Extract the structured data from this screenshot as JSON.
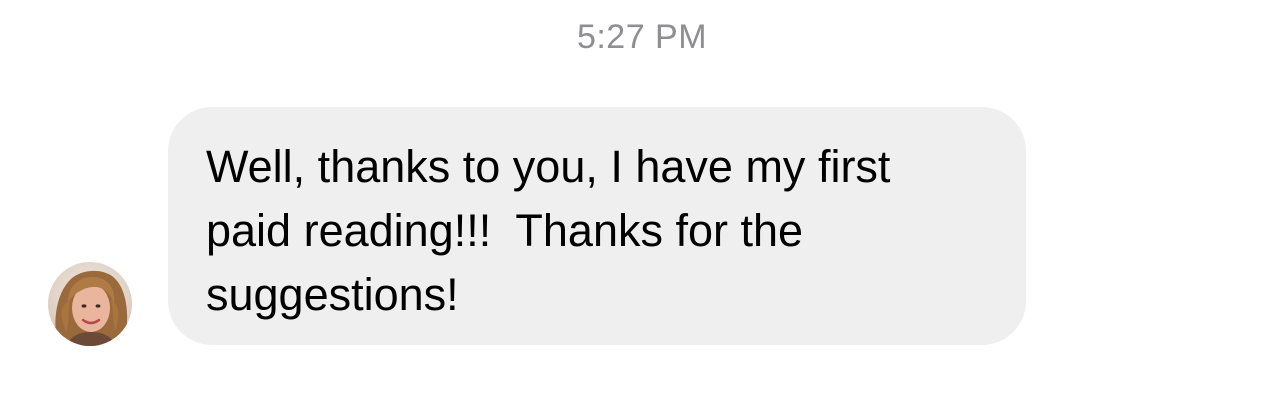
{
  "conversation": {
    "timestamp": "5:27 PM",
    "messages": [
      {
        "direction": "incoming",
        "sender_avatar": "person-avatar",
        "text": "Well, thanks to you, I have my first\npaid reading!!!  Thanks for the\nsuggestions!"
      }
    ]
  },
  "colors": {
    "bubble_background": "#efefef",
    "timestamp_text": "#8e8e93",
    "message_text": "#000000"
  }
}
